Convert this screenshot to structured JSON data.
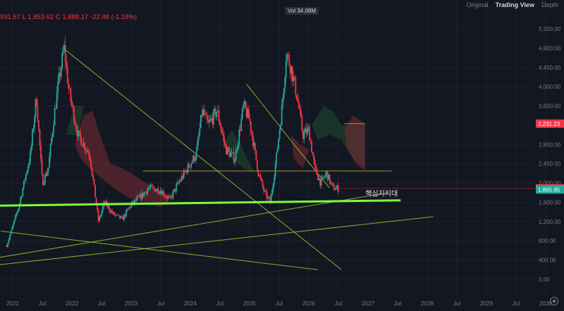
{
  "header": {
    "ohlc_text": "931.57  L 1,853.62  C 1,888.17  -22.48 (-1.18%)",
    "vol_label": "Vol  34.08M",
    "view_tabs": [
      "Original",
      "Trading View",
      "Depth"
    ],
    "active_tab": "Trading View"
  },
  "colors": {
    "background": "#131722",
    "up": "#26a69a",
    "down": "#f23645",
    "support_line": "#7cfc3c",
    "trend_line": "#9acd32",
    "cloud_bear": "#7a2a33",
    "cloud_bull": "#1f4a2e",
    "grid": "#1e222d"
  },
  "annotation_label": "핵심지지대",
  "price_badges": [
    {
      "value": "3,231.23",
      "price": 3231.23,
      "color": "#f23645"
    },
    {
      "value": "1,888.17",
      "price": 1888.17,
      "color": "#f23645"
    },
    {
      "value": "1,865.95",
      "price": 1865.95,
      "color": "#26a69a"
    }
  ],
  "chart_data": {
    "type": "candlestick",
    "x_tick_labels": [
      "2021",
      "Jul",
      "2022",
      "Jul",
      "2023",
      "Jul",
      "2024",
      "Jul",
      "2025",
      "Jul",
      "2026",
      "Jul",
      "2027",
      "Jul",
      "2028",
      "Jul",
      "2029",
      "Jul",
      "2030"
    ],
    "y_tick_labels": [
      "0.00",
      "400.00",
      "800.00",
      "1,200.00",
      "1,600.00",
      "2,000.00",
      "2,400.00",
      "2,800.00",
      "3,200.00",
      "3,600.00",
      "4,000.00",
      "4,400.00",
      "4,800.00",
      "5,200.00"
    ],
    "y_ticks": [
      0,
      400,
      800,
      1200,
      1600,
      2000,
      2400,
      2800,
      3200,
      3600,
      4000,
      4400,
      4800,
      5200
    ],
    "ylim": [
      -100,
      5500
    ],
    "close_path": [
      [
        2020.9,
        700
      ],
      [
        2021.1,
        1500
      ],
      [
        2021.3,
        2600
      ],
      [
        2021.4,
        3800
      ],
      [
        2021.5,
        2000
      ],
      [
        2021.6,
        2300
      ],
      [
        2021.7,
        3400
      ],
      [
        2021.8,
        4300
      ],
      [
        2021.87,
        4800
      ],
      [
        2021.95,
        3900
      ],
      [
        2022.1,
        3000
      ],
      [
        2022.3,
        2600
      ],
      [
        2022.45,
        1200
      ],
      [
        2022.55,
        1600
      ],
      [
        2022.7,
        1350
      ],
      [
        2022.85,
        1250
      ],
      [
        2023.0,
        1550
      ],
      [
        2023.15,
        1700
      ],
      [
        2023.3,
        1900
      ],
      [
        2023.5,
        1850
      ],
      [
        2023.65,
        1650
      ],
      [
        2023.8,
        2000
      ],
      [
        2023.95,
        2300
      ],
      [
        2024.1,
        2600
      ],
      [
        2024.2,
        3500
      ],
      [
        2024.3,
        3200
      ],
      [
        2024.45,
        3500
      ],
      [
        2024.6,
        2700
      ],
      [
        2024.75,
        2500
      ],
      [
        2024.9,
        3600
      ],
      [
        2025.0,
        3300
      ],
      [
        2025.15,
        2200
      ],
      [
        2025.25,
        1800
      ],
      [
        2025.35,
        1600
      ],
      [
        2025.45,
        2500
      ],
      [
        2025.55,
        3600
      ],
      [
        2025.62,
        4700
      ],
      [
        2025.7,
        4400
      ],
      [
        2025.8,
        3800
      ],
      [
        2025.9,
        3000
      ],
      [
        2026.0,
        3100
      ],
      [
        2026.1,
        2300
      ],
      [
        2026.2,
        2000
      ],
      [
        2026.3,
        2200
      ],
      [
        2026.4,
        1900
      ],
      [
        2026.5,
        1880
      ]
    ],
    "support_line": {
      "label": "핵심지지대",
      "from": [
        2020.75,
        1530
      ],
      "to": [
        2027.55,
        1640
      ]
    },
    "key_levels": [
      {
        "price": 2250,
        "from": 2023.2,
        "to": 2027.4
      },
      {
        "price": 3231.23,
        "from": 2026.6,
        "to": 2026.95
      }
    ],
    "current_price": 1888.17
  }
}
